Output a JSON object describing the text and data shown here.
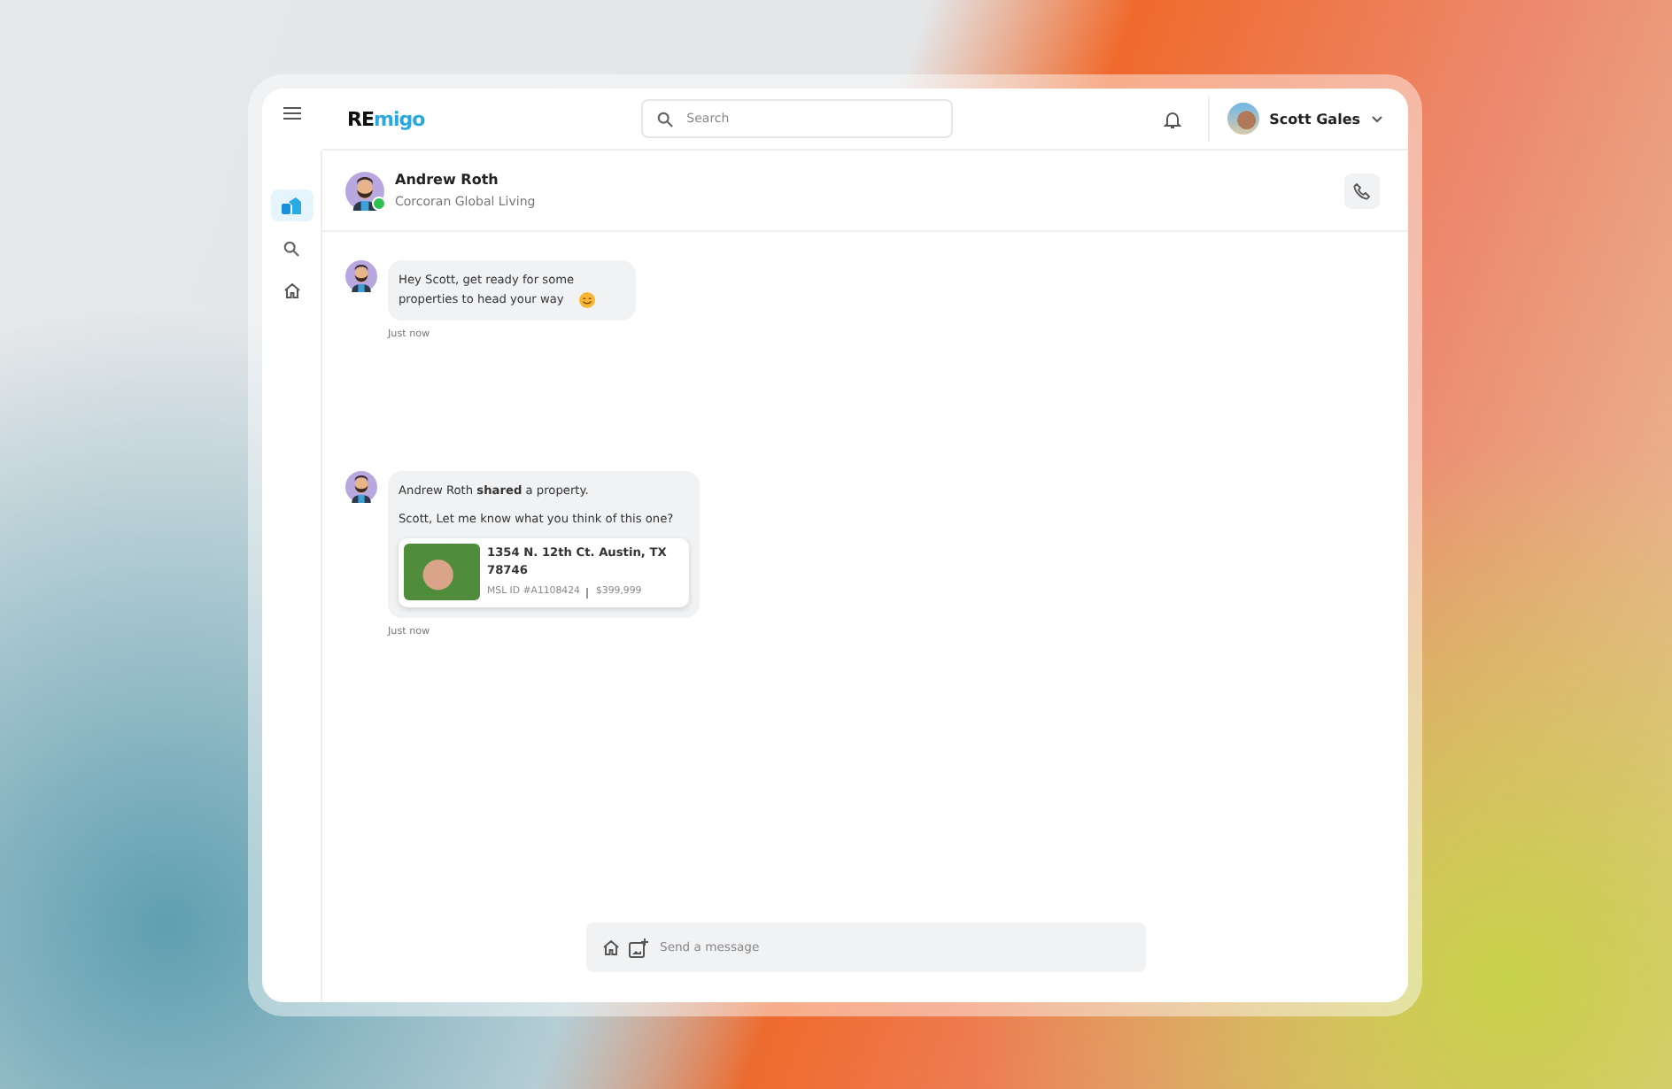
{
  "logo": {
    "prefix": "RE",
    "suffix": "migo"
  },
  "search": {
    "placeholder": "Search"
  },
  "user": {
    "name": "Scott Gales"
  },
  "sidebar": {
    "items": [
      {
        "selected": true
      },
      {
        "selected": false
      },
      {
        "selected": false
      }
    ]
  },
  "contact": {
    "name": "Andrew Roth",
    "company": "Corcoran Global Living",
    "online": true
  },
  "messages": [
    {
      "kind": "text",
      "text": "Hey Scott, get ready for some properties to head your way",
      "time": "Just now"
    },
    {
      "kind": "share",
      "text": "Andrew Roth **shared** a property.",
      "note": "Scott, Let me know what you think of this one?",
      "property": {
        "address": "1354 N. 12th Ct. Austin, TX 78746",
        "mls": "MSL ID #A1108424",
        "price": "$399,999"
      },
      "time": "Just now"
    }
  ],
  "composer": {
    "placeholder": "Send a message"
  }
}
